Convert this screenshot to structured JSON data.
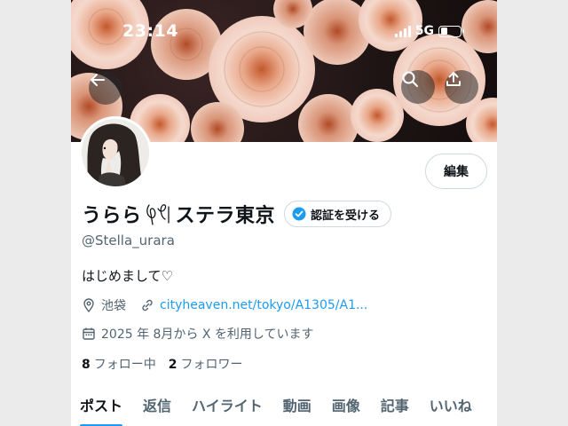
{
  "status_bar": {
    "time": "23:14",
    "network": "5G",
    "battery_level": 0.35
  },
  "banner_buttons": {
    "back_icon": "arrow-left-icon",
    "search_icon": "search-icon",
    "share_icon": "share-icon"
  },
  "profile": {
    "name_part1": "うらら",
    "name_part2": "ステラ東京",
    "handle": "@Stella_urara",
    "bio": "はじめまして♡",
    "location": "池袋",
    "website": "cityheaven.net/tokyo/A1305/A1...",
    "joined": "2025 年 8月から X を利用しています",
    "following_count": "8",
    "following_label": "フォロー中",
    "followers_count": "2",
    "followers_label": "フォロワー"
  },
  "buttons": {
    "edit": "編集",
    "verify": "認証を受ける"
  },
  "tabs": [
    {
      "label": "ポスト",
      "active": true
    },
    {
      "label": "返信",
      "active": false
    },
    {
      "label": "ハイライト",
      "active": false
    },
    {
      "label": "動画",
      "active": false
    },
    {
      "label": "画像",
      "active": false
    },
    {
      "label": "記事",
      "active": false
    },
    {
      "label": "いいね",
      "active": false
    }
  ],
  "colors": {
    "accent": "#1d9bf0",
    "text": "#0f1419",
    "muted": "#536471"
  }
}
